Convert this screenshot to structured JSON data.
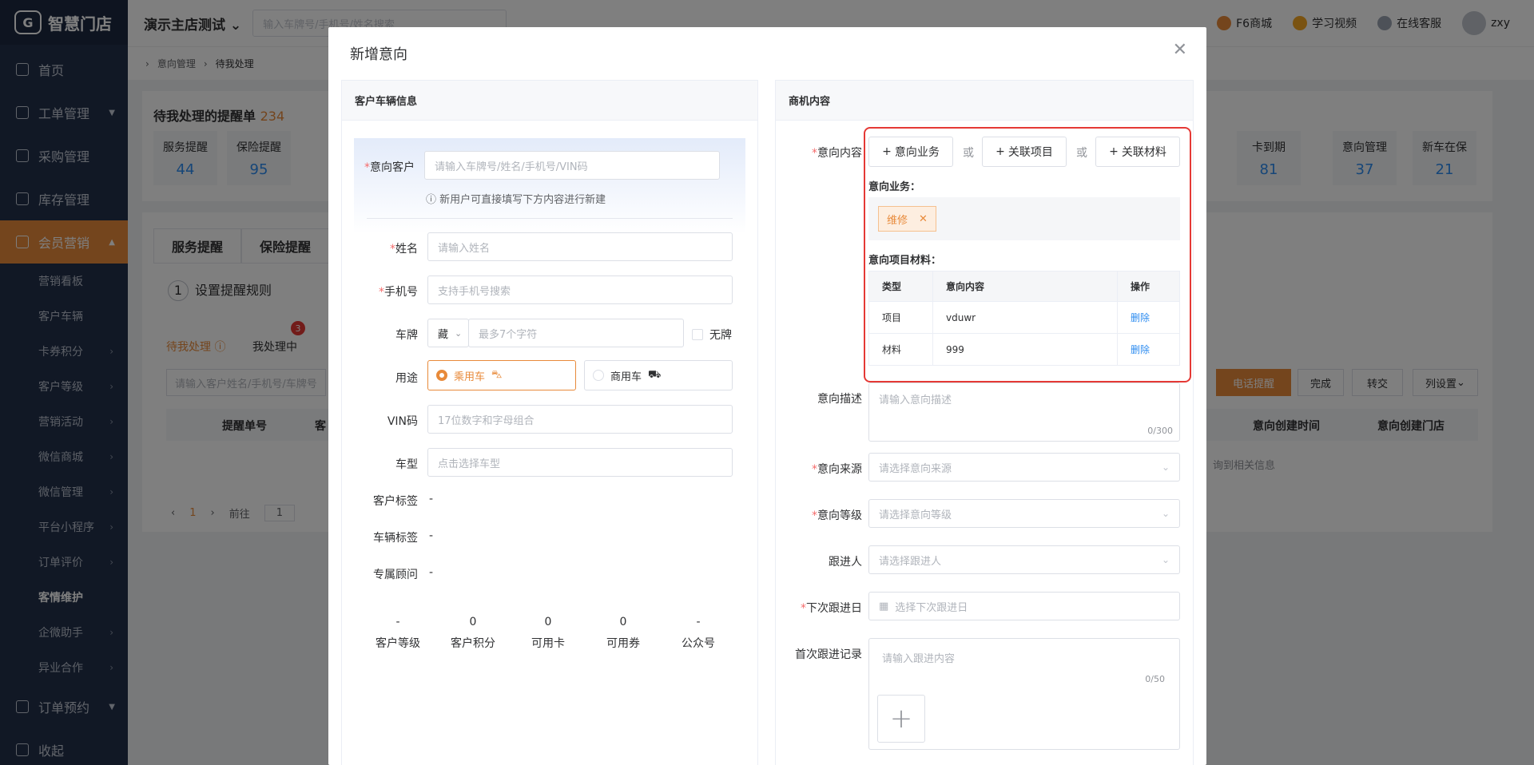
{
  "app": {
    "logo_text": "智慧门店",
    "store": "演示主店测试",
    "search_placeholder": "输入车牌号/手机号/姓名搜索",
    "top_links": [
      "F6商城",
      "学习视频",
      "在线客服",
      "zxy"
    ]
  },
  "sidebar": {
    "items": [
      {
        "label": "首页"
      },
      {
        "label": "工单管理"
      },
      {
        "label": "采购管理"
      },
      {
        "label": "库存管理"
      },
      {
        "label": "会员营销"
      }
    ],
    "sub_items": [
      "营销看板",
      "客户车辆",
      "卡券积分",
      "客户等级",
      "营销活动",
      "微信商城",
      "微信管理",
      "平台小程序",
      "订单评价",
      "客情维护",
      "企微助手",
      "异业合作"
    ],
    "bottom": [
      {
        "label": "订单预约"
      },
      {
        "label": "收起"
      }
    ]
  },
  "breadcrumb": [
    "意向管理",
    "待我处理"
  ],
  "background": {
    "title": "待我处理的提醒单",
    "count": "234",
    "stats": [
      {
        "label": "服务提醒",
        "value": "44"
      },
      {
        "label": "保险提醒",
        "value": "95"
      },
      {
        "label": "卡到期",
        "value": "81"
      },
      {
        "label": "意向管理",
        "value": "37"
      },
      {
        "label": "新车在保",
        "value": "21"
      }
    ],
    "tabs": [
      "服务提醒",
      "保险提醒"
    ],
    "step": "设置提醒规则",
    "subtabs": [
      "待我处理",
      "我处理中"
    ],
    "badge": "3",
    "filter_placeholder": "请输入客户姓名/手机号/车牌号",
    "buttons": [
      "电话提醒",
      "完成",
      "转交",
      "列设置"
    ],
    "columns": [
      "提醒单号",
      "客",
      "意向创建时间",
      "意向创建门店"
    ],
    "empty": "询到相关信息",
    "pager": {
      "page": "1",
      "goto": "前往",
      "input": "1"
    }
  },
  "dialog": {
    "title": "新增意向",
    "left": {
      "header": "客户车辆信息",
      "customer_label": "意向客户",
      "customer_placeholder": "请输入车牌号/姓名/手机号/VIN码",
      "hint": "新用户可直接填写下方内容进行新建",
      "name_label": "姓名",
      "name_placeholder": "请输入姓名",
      "phone_label": "手机号",
      "phone_placeholder": "支持手机号搜索",
      "plate_label": "车牌",
      "plate_prefix": "藏",
      "plate_placeholder": "最多7个字符",
      "no_plate": "无牌",
      "usage_label": "用途",
      "usage_options": [
        "乘用车",
        "商用车"
      ],
      "vin_label": "VIN码",
      "vin_placeholder": "17位数字和字母组合",
      "model_label": "车型",
      "model_placeholder": "点击选择车型",
      "customer_tag_label": "客户标签",
      "customer_tag_value": "-",
      "vehicle_tag_label": "车辆标签",
      "vehicle_tag_value": "-",
      "advisor_label": "专属顾问",
      "advisor_value": "-",
      "stats": [
        {
          "value": "-",
          "label": "客户等级"
        },
        {
          "value": "0",
          "label": "客户积分"
        },
        {
          "value": "0",
          "label": "可用卡"
        },
        {
          "value": "0",
          "label": "可用券"
        },
        {
          "value": "-",
          "label": "公众号"
        }
      ]
    },
    "right": {
      "header": "商机内容",
      "content_label": "意向内容",
      "btn_business": "意向业务",
      "or1": "或",
      "btn_project": "关联项目",
      "or2": "或",
      "btn_material": "关联材料",
      "business_title": "意向业务：",
      "tag": "维修",
      "materials_title": "意向项目材料：",
      "table_headers": [
        "类型",
        "意向内容",
        "操作"
      ],
      "rows": [
        {
          "type": "项目",
          "content": "vduwr",
          "action": "删除"
        },
        {
          "type": "材料",
          "content": "999",
          "action": "删除"
        }
      ],
      "desc_label": "意向描述",
      "desc_placeholder": "请输入意向描述",
      "desc_count": "0/300",
      "source_label": "意向来源",
      "source_placeholder": "请选择意向来源",
      "level_label": "意向等级",
      "level_placeholder": "请选择意向等级",
      "follower_label": "跟进人",
      "follower_placeholder": "请选择跟进人",
      "next_label": "下次跟进日",
      "next_placeholder": "选择下次跟进日",
      "first_label": "首次跟进记录",
      "first_placeholder": "请输入跟进内容",
      "first_count": "0/50"
    }
  },
  "colors": {
    "accent": "#e88a3a",
    "sidebar": "#22304a",
    "link": "#2d8cf0",
    "highlight": "#e53935"
  }
}
